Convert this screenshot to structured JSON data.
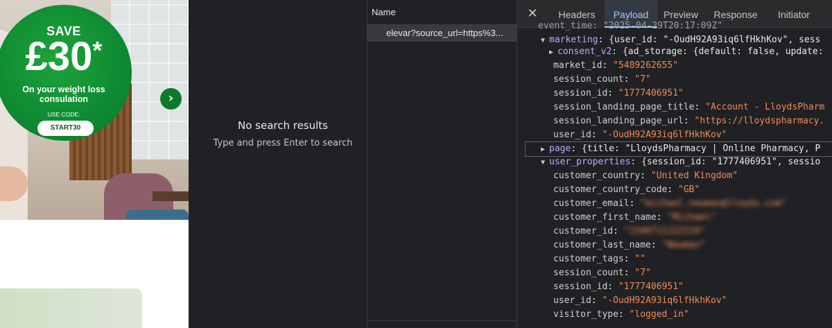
{
  "promo": {
    "save_label": "SAVE",
    "amount": "£30",
    "asterisk": "*",
    "subtitle_line1": "On your weight loss",
    "subtitle_line2": "consulation",
    "use_code_label": "USE CODE:",
    "code": "START30"
  },
  "search": {
    "title": "No search results",
    "hint": "Type and press Enter to search"
  },
  "network": {
    "column_header": "Name",
    "selected_request": "elevar?source_url=https%3..."
  },
  "tabs": [
    {
      "label": "Headers",
      "active": false
    },
    {
      "label": "Payload",
      "active": true
    },
    {
      "label": "Preview",
      "active": false
    },
    {
      "label": "Response",
      "active": false
    },
    {
      "label": "Initiator",
      "active": false
    }
  ],
  "payload": {
    "top_cut": "event_time: \"2025-04-29T20:17:09Z\"",
    "marketing": {
      "key": "marketing",
      "summary": "{user_id: \"-OudH92A93iq6lfHkhKov\", sess",
      "consent_key": "consent_v2",
      "consent_summary": "{ad_storage: {default: false, update:",
      "fields": [
        {
          "k": "market_id",
          "v": "\"5489262655\""
        },
        {
          "k": "session_count",
          "v": "\"7\""
        },
        {
          "k": "session_id",
          "v": "\"1777406951\""
        },
        {
          "k": "session_landing_page_title",
          "v": "\"Account - LloydsPharm"
        },
        {
          "k": "session_landing_page_url",
          "v": "\"https://lloydspharmacy."
        },
        {
          "k": "user_id",
          "v": "\"-OudH92A93iq6lfHkhKov\""
        }
      ]
    },
    "page": {
      "key": "page",
      "summary": "{title: \"LloydsPharmacy | Online Pharmacy, P"
    },
    "user_properties": {
      "key": "user_properties",
      "summary": "{session_id: \"1777406951\", sessio",
      "fields": [
        {
          "k": "customer_country",
          "v": "\"United Kingdom\""
        },
        {
          "k": "customer_country_code",
          "v": "\"GB\""
        },
        {
          "k": "customer_email",
          "v": "\"michael.newman@lloyds.com\""
        },
        {
          "k": "customer_first_name",
          "v": "\"Michael\""
        },
        {
          "k": "customer_id",
          "v": "\"2340711222219\""
        },
        {
          "k": "customer_last_name",
          "v": "\"Newman\""
        },
        {
          "k": "customer_tags",
          "v": "\"\""
        },
        {
          "k": "session_count",
          "v": "\"7\""
        },
        {
          "k": "session_id",
          "v": "\"1777406951\""
        },
        {
          "k": "user_id",
          "v": "\"-OudH92A93iq6lfHkhKov\""
        },
        {
          "k": "visitor_type",
          "v": "\"logged_in\""
        }
      ]
    }
  },
  "icons": {
    "close": "close-icon",
    "carousel_next": "chevron-right-icon",
    "expand": "triangle-right-icon",
    "collapse": "triangle-down-icon"
  },
  "colors": {
    "promo_green": "#0e8a32",
    "tab_active": "#a8c7fa",
    "string_value": "#f28b54"
  }
}
